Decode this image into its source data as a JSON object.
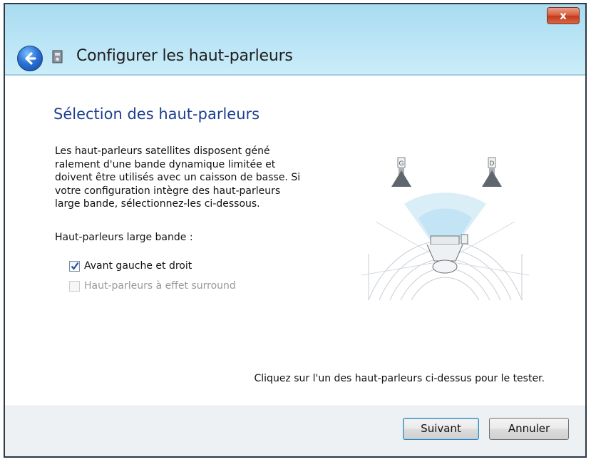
{
  "window": {
    "title": "Configurer les haut-parleurs",
    "close_label": "x"
  },
  "page": {
    "heading": "Sélection des haut-parleurs",
    "description_lines": [
      "Les haut-parleurs satellites disposent géné",
      "ralement d'une bande dynamique limitée et",
      "doivent être utilisés avec un caisson de basse. Si",
      "votre configuration intègre des haut-parleurs",
      "large bande, sélectionnez-les ci-dessous."
    ],
    "group_label": "Haut-parleurs large bande :",
    "options": [
      {
        "label": "Avant gauche et droit",
        "checked": true,
        "enabled": true
      },
      {
        "label": "Haut-parleurs à effet surround",
        "checked": false,
        "enabled": false
      }
    ],
    "hint": "Cliquez sur l'un des haut-parleurs ci-dessus pour le tester."
  },
  "diagram": {
    "speaker_left_label": "G",
    "speaker_right_label": "D"
  },
  "buttons": {
    "next": "Suivant",
    "cancel": "Annuler"
  },
  "colors": {
    "title_bar": "#b7e4f5",
    "heading": "#1d3f8f",
    "close_button": "#c23b1a",
    "footer": "#eef1f4"
  }
}
